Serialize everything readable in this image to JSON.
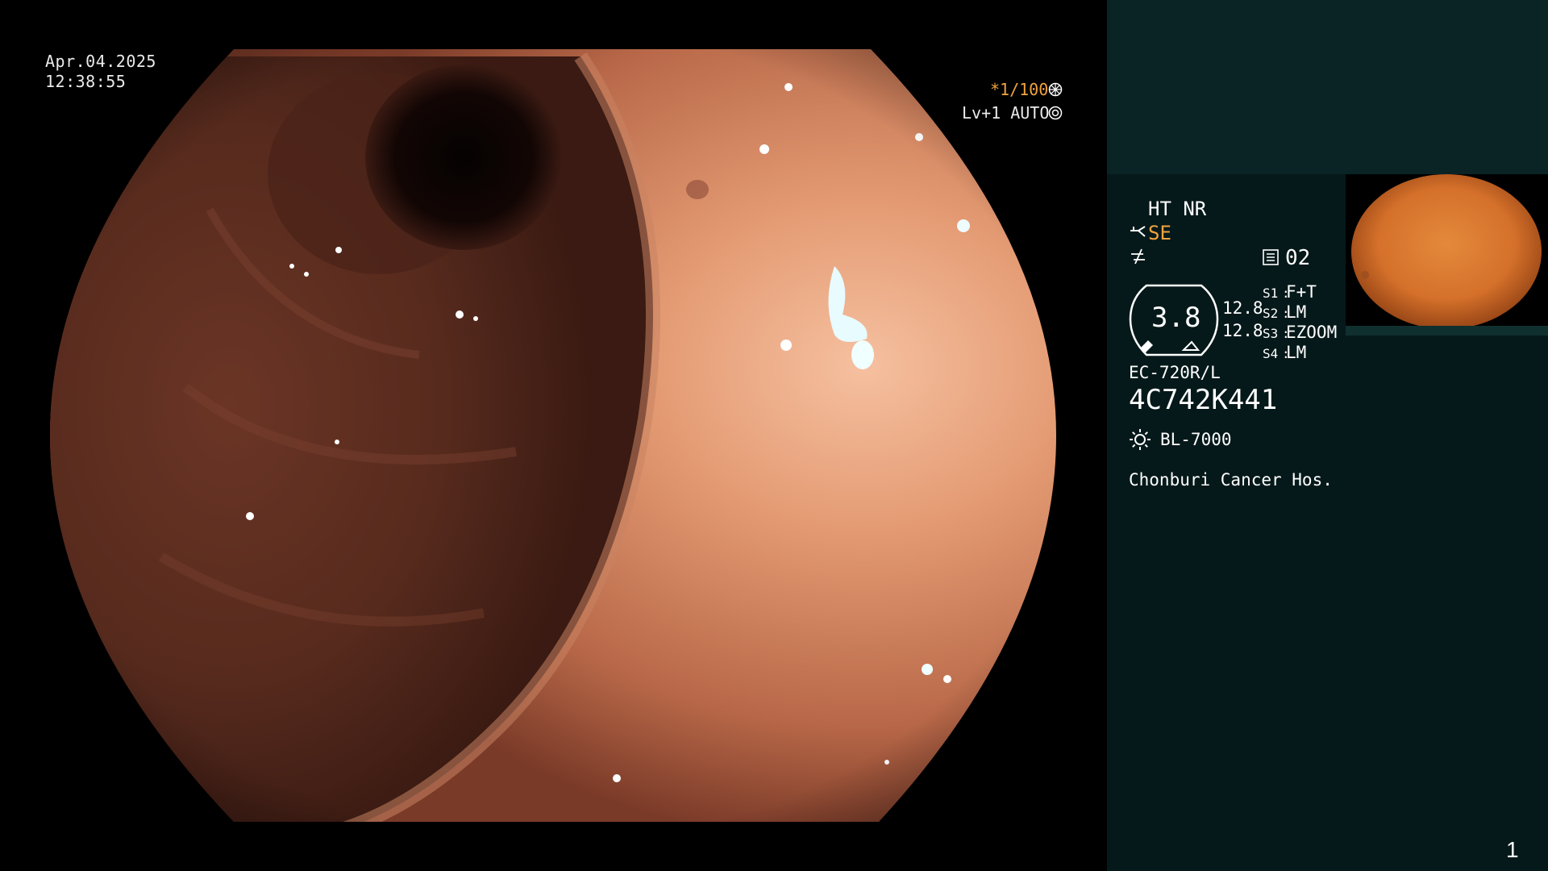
{
  "overlay": {
    "date": "Apr.04.2025",
    "time": "12:38:55",
    "shutter": "*1/100",
    "level": "Lv+1 AUTO"
  },
  "panel": {
    "ht_nr": "HT NR",
    "se": "SE",
    "memory_index": "02",
    "gauge_value": "3.8",
    "value_top": "12.8",
    "value_bottom": "12.8",
    "switches": [
      {
        "key": "S1",
        "value": "F+T"
      },
      {
        "key": "S2",
        "value": "LM"
      },
      {
        "key": "S3",
        "value": "EZOOM"
      },
      {
        "key": "S4",
        "value": "LM"
      }
    ],
    "scope_model": "EC-720R/L",
    "scope_serial": "4C742K441",
    "light_source": "BL-7000",
    "hospital": "Chonburi Cancer Hos."
  },
  "page_number": "1",
  "colors": {
    "panel_bg": "#06191a",
    "panel_top_bg": "#0a2426",
    "accent_orange": "#f0a440",
    "mucosa_light": "#e8a47c",
    "mucosa_dark": "#5a2a1e"
  },
  "icons": [
    "shutter-icon",
    "auto-iris-icon",
    "scope-icon",
    "bend-icon",
    "memory-icon",
    "light-source-icon"
  ]
}
